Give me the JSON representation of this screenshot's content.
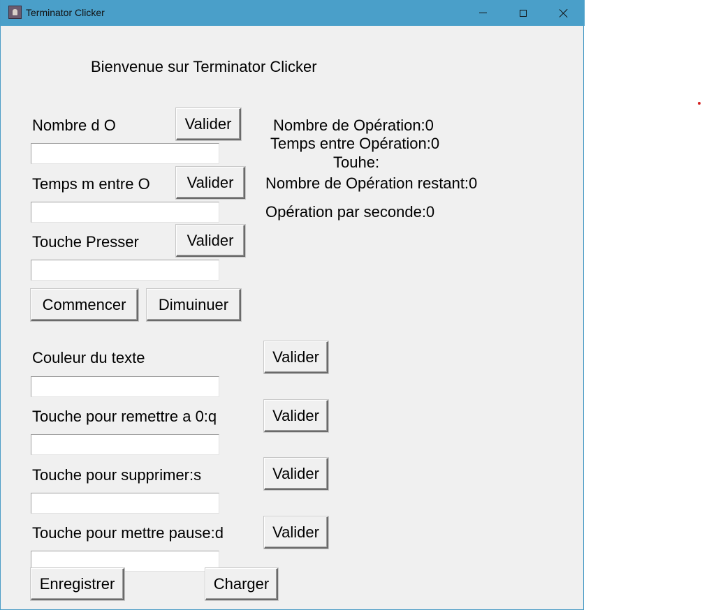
{
  "window": {
    "title": "Terminator Clicker",
    "controls": {
      "minimize": "minimize",
      "maximize": "maximize",
      "close": "close"
    }
  },
  "welcome": "Bienvenue sur Terminator Clicker",
  "settings": [
    {
      "label": "Nombre d O",
      "button": "Valider",
      "value": ""
    },
    {
      "label": "Temps m entre O",
      "button": "Valider",
      "value": ""
    },
    {
      "label": "Touche Presser",
      "button": "Valider",
      "value": ""
    }
  ],
  "status": {
    "nombre_operation": "Nombre de Opération:0",
    "temps_entre": "Temps entre Opération:0",
    "touche": "Touhe:",
    "restant": "Nombre de Opération restant:0",
    "par_seconde": "Opération par seconde:0"
  },
  "actions": {
    "start": "Commencer",
    "decrease": "Dimuinuer"
  },
  "options": [
    {
      "label": "Couleur du texte",
      "button": "Valider",
      "value": ""
    },
    {
      "label": "Touche pour remettre a 0:q",
      "button": "Valider",
      "value": ""
    },
    {
      "label": "Touche pour supprimer:s",
      "button": "Valider",
      "value": ""
    },
    {
      "label": "Touche pour mettre pause:d",
      "button": "Valider",
      "value": ""
    }
  ],
  "footer": {
    "save": "Enregistrer",
    "load": "Charger"
  }
}
